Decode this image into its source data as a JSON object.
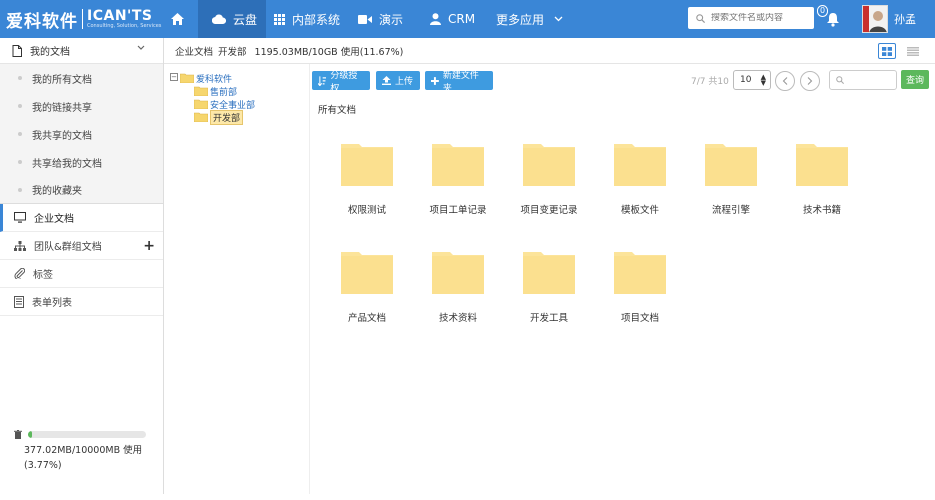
{
  "brand": {
    "name_cn": "爱科软件",
    "name_en": "ICAN'TS",
    "tagline": "Consulting, Solution, Services"
  },
  "nav": {
    "items": [
      {
        "label": "云盘",
        "icon": "cloud-icon",
        "active": true
      },
      {
        "label": "内部系统",
        "icon": "grid-icon"
      },
      {
        "label": "演示",
        "icon": "video-icon"
      },
      {
        "label": "CRM",
        "icon": "user-icon"
      },
      {
        "label": "更多应用",
        "icon": "chevron-down-icon"
      }
    ],
    "search_placeholder": "搜索文件名或内容",
    "notification_count": "0",
    "username": "孙孟"
  },
  "sidebar": {
    "header": "我的文档",
    "sub_items": [
      "我的所有文档",
      "我的链接共享",
      "我共享的文档",
      "共享给我的文档",
      "我的收藏夹"
    ],
    "items": [
      {
        "label": "企业文档",
        "icon": "monitor-icon",
        "active": true
      },
      {
        "label": "团队&群组文档",
        "icon": "org-chart-icon"
      },
      {
        "label": "标签",
        "icon": "paperclip-icon"
      },
      {
        "label": "表单列表",
        "icon": "form-icon"
      }
    ],
    "quota": {
      "used_fraction": 0.0377,
      "line1": "377.02MB/10000MB 使用",
      "line2": "(3.77%)"
    }
  },
  "breadcrumb": {
    "root": "企业文档",
    "current": "开发部",
    "usage": "1195.03MB/10GB 使用(11.67%)"
  },
  "tree": {
    "root": "爱科软件",
    "children": [
      "售前部",
      "安全事业部",
      "开发部"
    ],
    "selected": "开发部"
  },
  "toolbar": {
    "perm_label": "分级授权",
    "upload_label": "上传",
    "new_folder_label": "新建文件夹",
    "pager_info": "7/7 共10",
    "page_size": "10",
    "query_label": "查询"
  },
  "main": {
    "section_title": "所有文档",
    "folders": [
      "权限测试",
      "项目工单记录",
      "项目变更记录",
      "模板文件",
      "流程引擎",
      "技术书籍",
      "产品文档",
      "技术资料",
      "开发工具",
      "项目文档"
    ]
  },
  "colors": {
    "topbar": "#3a86d6",
    "topbar_active": "#2d6fb8",
    "button_blue": "#3e9be0",
    "button_green": "#5cb85c",
    "folder": "#fce49a"
  }
}
